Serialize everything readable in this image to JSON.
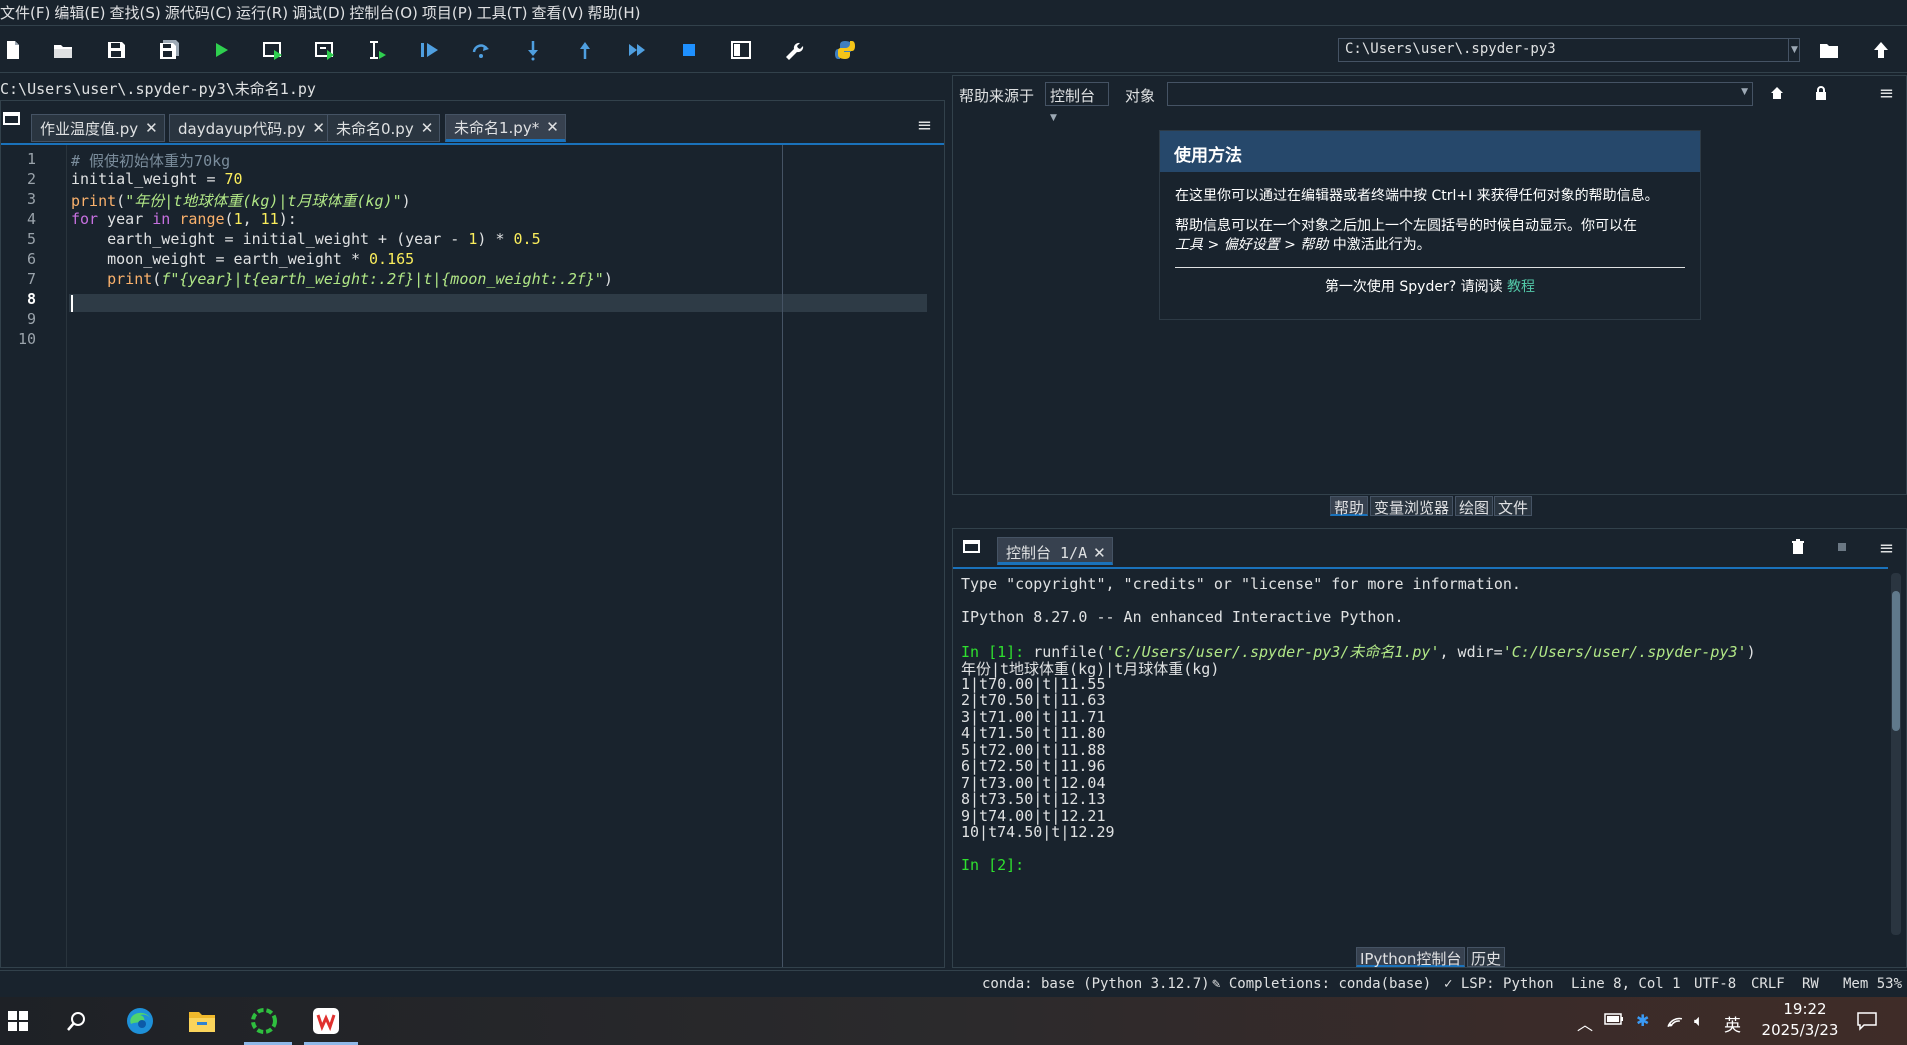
{
  "menu": [
    "文件(F)",
    "编辑(E)",
    "查找(S)",
    "源代码(C)",
    "运行(R)",
    "调试(D)",
    "控制台(O)",
    "项目(P)",
    "工具(T)",
    "查看(V)",
    "帮助(H)"
  ],
  "toolbar": {
    "working_dir": "C:\\Users\\user\\.spyder-py3"
  },
  "editor": {
    "file_path": "C:\\Users\\user\\.spyder-py3\\未命名1.py",
    "tabs": [
      {
        "label": "作业温度值.py",
        "active": false
      },
      {
        "label": "daydayup代码.py",
        "active": false
      },
      {
        "label": "未命名0.py",
        "active": false
      },
      {
        "label": "未命名1.py*",
        "active": true
      }
    ],
    "line_numbers": [
      "1",
      "2",
      "3",
      "4",
      "5",
      "6",
      "7",
      "8",
      "9",
      "10"
    ],
    "current_line": 8,
    "code": {
      "l1": "# 假使初始体重为70kg",
      "l2_a": "initial_weight = ",
      "l2_b": "70",
      "l3_a": "print",
      "l3_b": "(",
      "l3_c": "\"年份|t地球体重(kg)|t月球体重(kg)\"",
      "l3_d": ")",
      "l4_a": "for",
      "l4_b": " year ",
      "l4_c": "in",
      "l4_d": " ",
      "l4_e": "range",
      "l4_f": "(",
      "l4_g": "1",
      "l4_h": ", ",
      "l4_i": "11",
      "l4_j": "):",
      "l5_a": "    earth_weight = initial_weight + (year - ",
      "l5_b": "1",
      "l5_c": ") * ",
      "l5_d": "0.5",
      "l6_a": "    moon_weight = earth_weight * ",
      "l6_b": "0.165",
      "l7_a": "    ",
      "l7_b": "print",
      "l7_c": "(",
      "l7_d": "f\"{year}|t{earth_weight:.2f}|t|{moon_weight:.2f}\"",
      "l7_e": ")"
    }
  },
  "help": {
    "source_label": "帮助来源于",
    "source_value": "控制台",
    "object_label": "对象",
    "card_title": "使用方法",
    "p1": "在这里你可以通过在编辑器或者终端中按 Ctrl+I 来获得任何对象的帮助信息。",
    "p2a": "帮助信息可以在一个对象之后加上一个左圆括号的时候自动显示。你可以在",
    "p2b": "工具 > 偏好设置 > 帮助",
    "p2c": " 中激活此行为。",
    "first_time": "第一次使用 Spyder? 请阅读 ",
    "tutorial_link": "教程",
    "bottom_tabs": [
      {
        "label": "帮助",
        "active": true
      },
      {
        "label": "变量浏览器",
        "active": false
      },
      {
        "label": "绘图",
        "active": false
      },
      {
        "label": "文件",
        "active": false
      }
    ]
  },
  "console": {
    "tab_label": "控制台 1/A",
    "lines": {
      "c1": "Type \"copyright\", \"credits\" or \"license\" for more information.",
      "c2": "IPython 8.27.0 -- An enhanced Interactive Python.",
      "c3_prompt": "In [1]: ",
      "c3_a": "runfile(",
      "c3_b": "'C:/Users/user/.spyder-py3/未命名1.py'",
      "c3_c": ", wdir=",
      "c3_d": "'C:/Users/user/.spyder-py3'",
      "c3_e": ")",
      "c4": "年份|t地球体重(kg)|t月球体重(kg)",
      "out": [
        "1|t70.00|t|11.55",
        "2|t70.50|t|11.63",
        "3|t71.00|t|11.71",
        "4|t71.50|t|11.80",
        "5|t72.00|t|11.88",
        "6|t72.50|t|11.96",
        "7|t73.00|t|12.04",
        "8|t73.50|t|12.13",
        "9|t74.00|t|12.21",
        "10|t74.50|t|12.29"
      ],
      "c_prompt2": "In [2]:"
    },
    "bottom_tabs": [
      {
        "label": "IPython控制台",
        "active": true
      },
      {
        "label": "历史",
        "active": false
      }
    ]
  },
  "status": {
    "conda": "conda: base (Python 3.12.7)",
    "completions": "Completions: conda(base)",
    "lsp": "LSP: Python",
    "position": "Line 8, Col 1",
    "encoding": "UTF-8",
    "eol": "CRLF",
    "rw": "RW",
    "mem": "Mem 53%"
  },
  "taskbar": {
    "ime": "英",
    "time": "19:22",
    "date": "2025/3/23"
  },
  "colors": {
    "background": "#19232d",
    "accent": "#1a72bb",
    "prompt": "#2fe02f",
    "string": "#b0e686",
    "keyword": "#c670e0",
    "number": "#faed5c"
  }
}
